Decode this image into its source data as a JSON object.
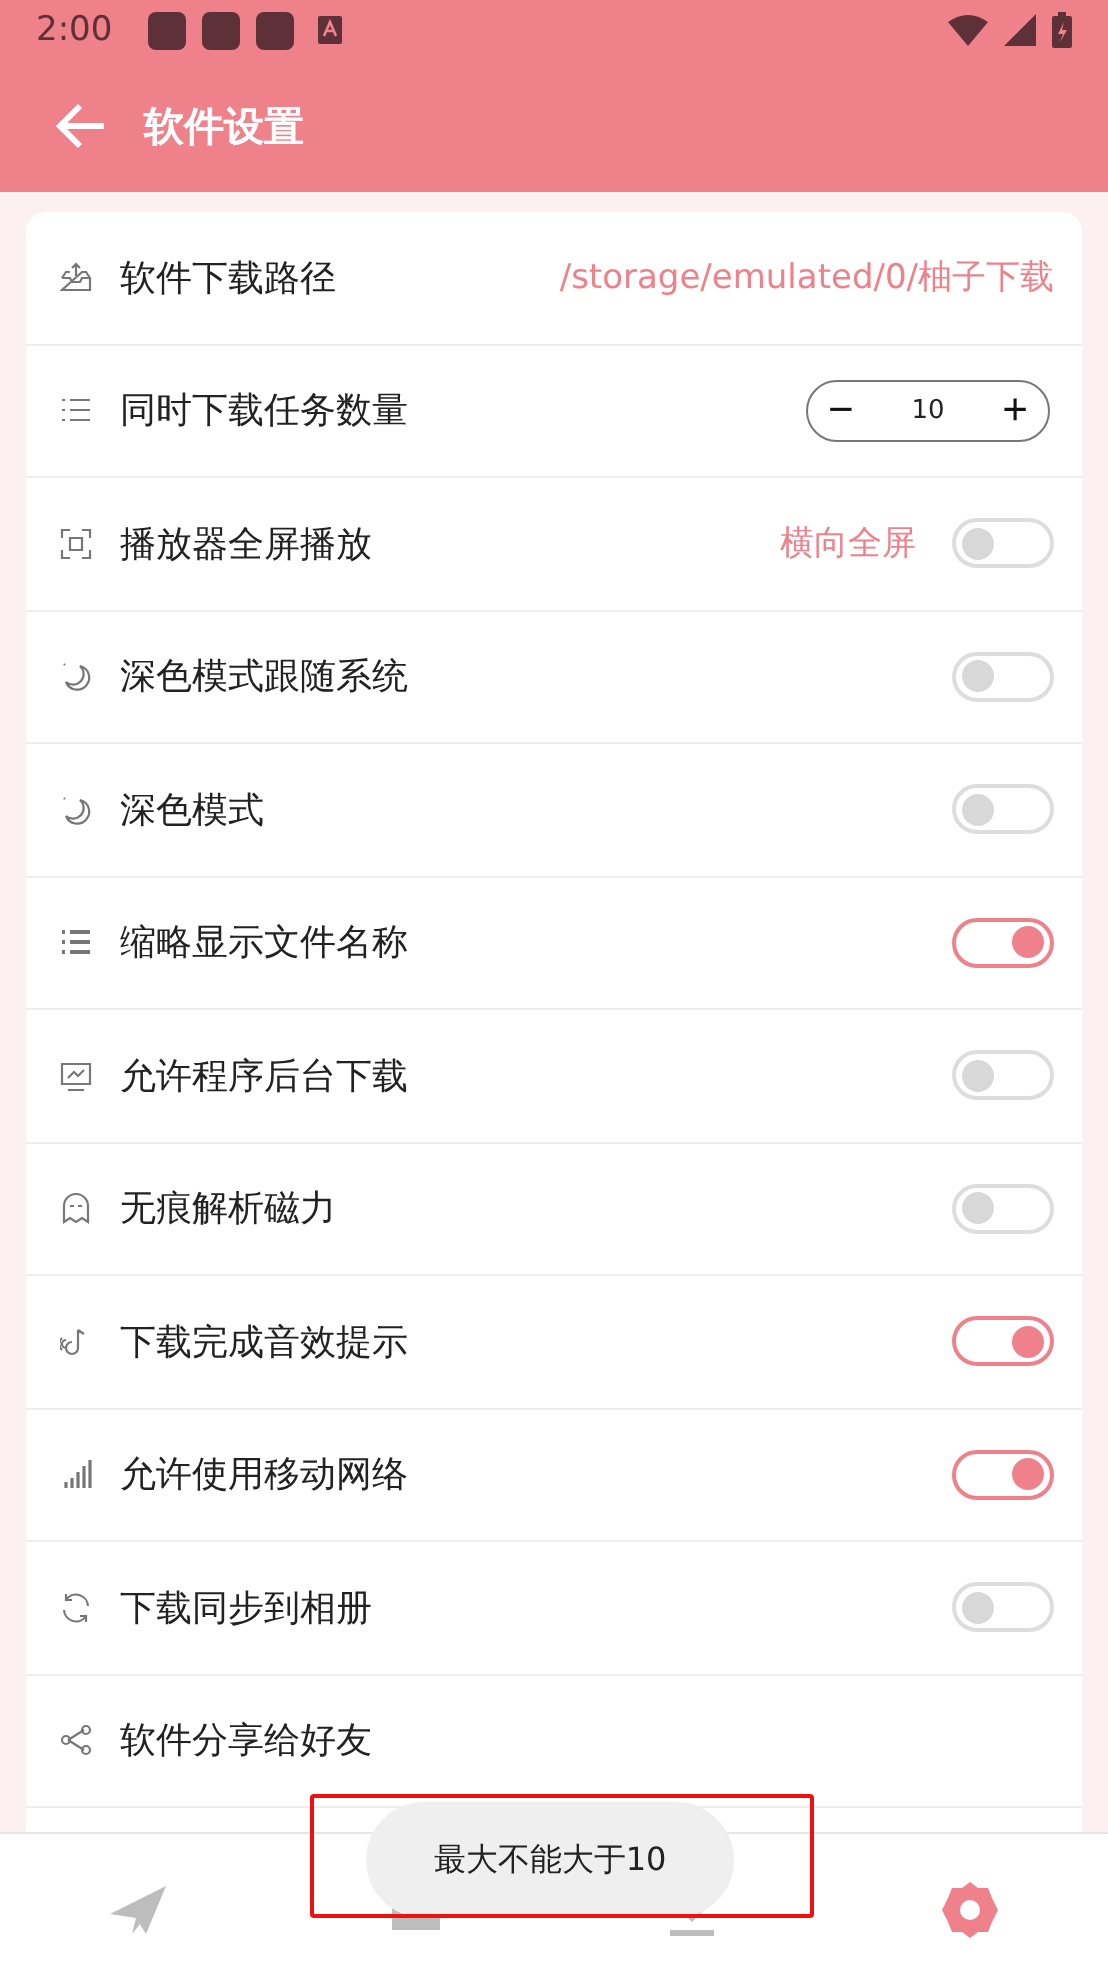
{
  "status_bar": {
    "time": "2:00"
  },
  "app_bar": {
    "title": "软件设置"
  },
  "settings": [
    {
      "kind": "value",
      "label": "软件下载路径",
      "value": "/storage/emulated/0/柚子下载"
    },
    {
      "kind": "stepper",
      "label": "同时下载任务数量",
      "minus": "−",
      "value": "10",
      "plus": "+"
    },
    {
      "kind": "toggle",
      "label": "播放器全屏播放",
      "note": "横向全屏",
      "on": false
    },
    {
      "kind": "toggle",
      "label": "深色模式跟随系统",
      "on": false
    },
    {
      "kind": "toggle",
      "label": "深色模式",
      "on": false
    },
    {
      "kind": "toggle",
      "label": "缩略显示文件名称",
      "on": true
    },
    {
      "kind": "toggle",
      "label": "允许程序后台下载",
      "on": false
    },
    {
      "kind": "toggle",
      "label": "无痕解析磁力",
      "on": false
    },
    {
      "kind": "toggle",
      "label": "下载完成音效提示",
      "on": true
    },
    {
      "kind": "toggle",
      "label": "允许使用移动网络",
      "on": true
    },
    {
      "kind": "toggle",
      "label": "下载同步到相册",
      "on": false
    },
    {
      "kind": "link",
      "label": "软件分享给好友"
    }
  ],
  "bottom_nav": [
    {
      "selected": false
    },
    {
      "selected": false
    },
    {
      "selected": false
    },
    {
      "selected": true
    }
  ],
  "toast": "最大不能大于10"
}
